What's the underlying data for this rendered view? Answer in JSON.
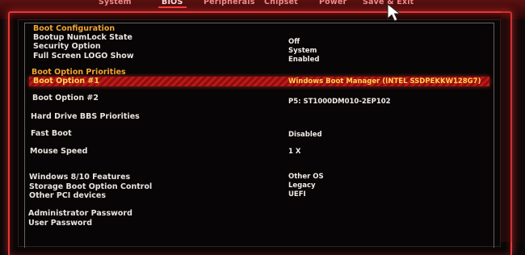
{
  "tabs": [
    {
      "label": "System"
    },
    {
      "label": "BIOS"
    },
    {
      "label": "Peripherals"
    },
    {
      "label": "Chipset"
    },
    {
      "label": "Power"
    },
    {
      "label": "Save & Exit"
    }
  ],
  "active_tab": "BIOS",
  "boot_config": {
    "heading": "Boot Configuration",
    "rows": [
      {
        "label": "Bootup NumLock State",
        "value": "Off"
      },
      {
        "label": "Security Option",
        "value": "System"
      },
      {
        "label": "Full Screen LOGO Show",
        "value": "Enabled"
      }
    ]
  },
  "boot_priorities": {
    "heading": "Boot Option Priorities",
    "option1": {
      "label": "Boot Option #1",
      "value": "Windows Boot Manager (INTEL SSDPEKKW128G7)"
    },
    "option2": {
      "label": "Boot Option #2",
      "value": "P5: ST1000DM010-2EP102"
    }
  },
  "settings": {
    "hdd_bbs": {
      "label": "Hard Drive BBS Priorities"
    },
    "fast_boot": {
      "label": "Fast Boot",
      "value": "Disabled"
    },
    "mouse_speed": {
      "label": "Mouse Speed",
      "value": "1 X"
    },
    "win_features": {
      "label": "Windows 8/10 Features",
      "value": "Other OS"
    },
    "storage_ctrl": {
      "label": "Storage Boot Option Control",
      "value": "Legacy"
    },
    "other_pci": {
      "label": "Other PCI devices",
      "value": "UEFI"
    },
    "admin_pw": {
      "label": "Administrator Password"
    },
    "user_pw": {
      "label": "User Password"
    }
  },
  "colors": {
    "accent_red": "#e23a3a",
    "section_orange": "#f2a633",
    "highlight_yellow": "#ffd24a"
  }
}
